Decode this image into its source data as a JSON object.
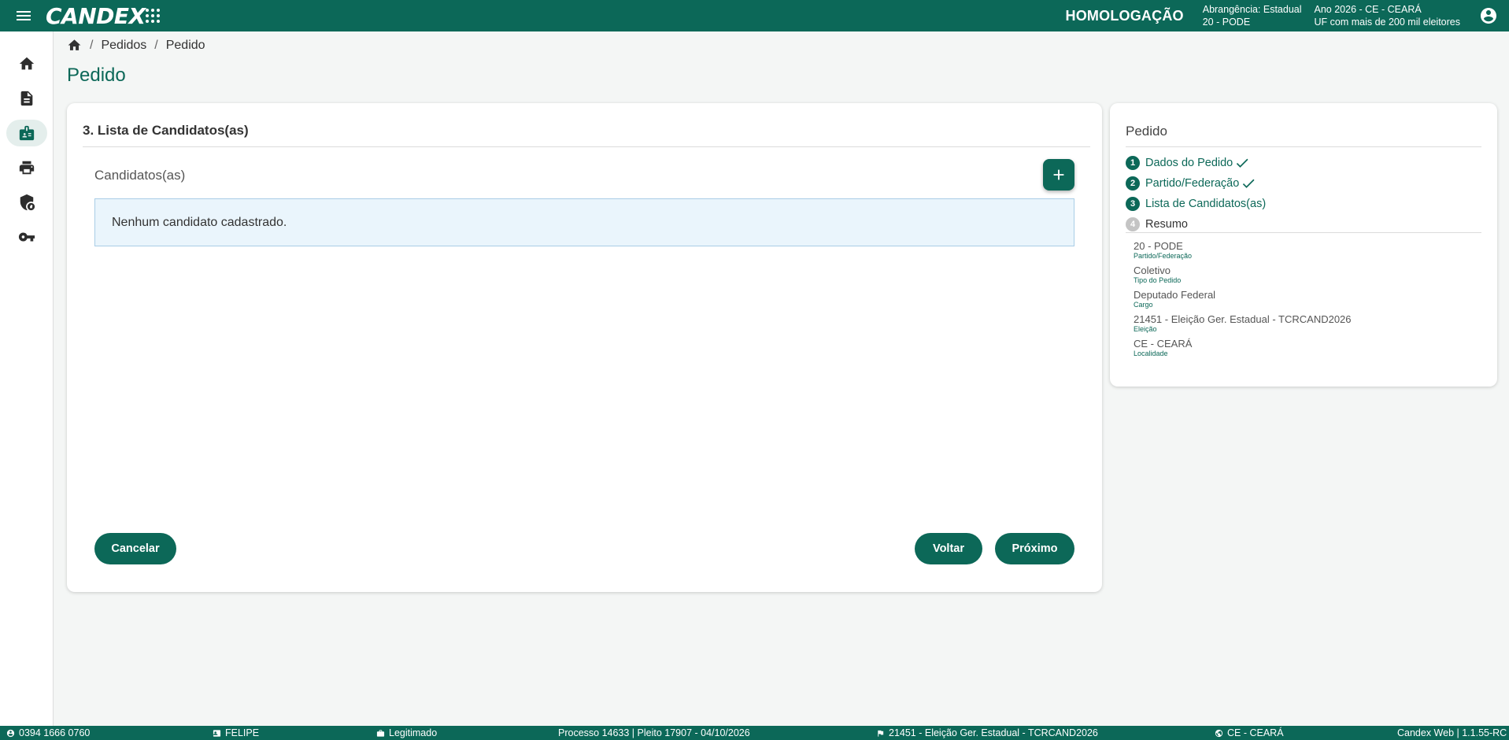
{
  "header": {
    "logo_text": "CANDEX",
    "environment": "HOMOLOGAÇÃO",
    "scope_line1": "Abrangência: Estadual",
    "scope_line2": "20 - PODE",
    "year_line1": "Ano 2026 - CE - CEARÁ",
    "year_line2": "UF com mais de 200 mil eleitores",
    "icons": [
      "menu-icon",
      "account-circle-icon"
    ]
  },
  "sidebar": {
    "items": [
      {
        "icon": "home-icon",
        "active": false
      },
      {
        "icon": "document-icon",
        "active": false
      },
      {
        "icon": "badge-icon",
        "active": true
      },
      {
        "icon": "printer-icon",
        "active": false
      },
      {
        "icon": "shield-lock-icon",
        "active": false
      },
      {
        "icon": "key-icon",
        "active": false
      }
    ]
  },
  "breadcrumb": {
    "items": [
      "Pedidos",
      "Pedido"
    ]
  },
  "page": {
    "title": "Pedido"
  },
  "main": {
    "step_title": "3. Lista de Candidatos(as)",
    "candidates_label": "Candidatos(as)",
    "empty_message": "Nenhum candidato cadastrado.",
    "buttons": {
      "cancel": "Cancelar",
      "back": "Voltar",
      "next": "Próximo"
    }
  },
  "side": {
    "title": "Pedido",
    "steps": [
      {
        "number": "1",
        "label": "Dados do Pedido",
        "done": true
      },
      {
        "number": "2",
        "label": "Partido/Federação",
        "done": true
      },
      {
        "number": "3",
        "label": "Lista de Candidatos(as)",
        "done": false
      },
      {
        "number": "4",
        "label": "Resumo",
        "done": false
      }
    ],
    "summary": [
      {
        "value": "20 - PODE",
        "label": "Partido/Federação"
      },
      {
        "value": "Coletivo",
        "label": "Tipo do Pedido"
      },
      {
        "value": "Deputado Federal",
        "label": "Cargo"
      },
      {
        "value": "21451 - Eleição Ger. Estadual - TCRCAND2026",
        "label": "Eleição"
      },
      {
        "value": "CE - CEARÁ",
        "label": "Localidade"
      }
    ]
  },
  "statusbar": {
    "user_id": "0394 1666 0760",
    "user_name": "FELIPE",
    "status": "Legitimado",
    "process": "Processo 14633 | Pleito 17907 - 04/10/2026",
    "election": "21451 - Eleição Ger. Estadual - TCRCAND2026",
    "locality": "CE - CEARÁ",
    "version": "Candex Web | 1.1.55-RC"
  },
  "colors": {
    "primary": "#0c6858",
    "background": "#f4f6f5",
    "alert_bg": "#eaf5fc",
    "alert_border": "#a9cde6"
  }
}
